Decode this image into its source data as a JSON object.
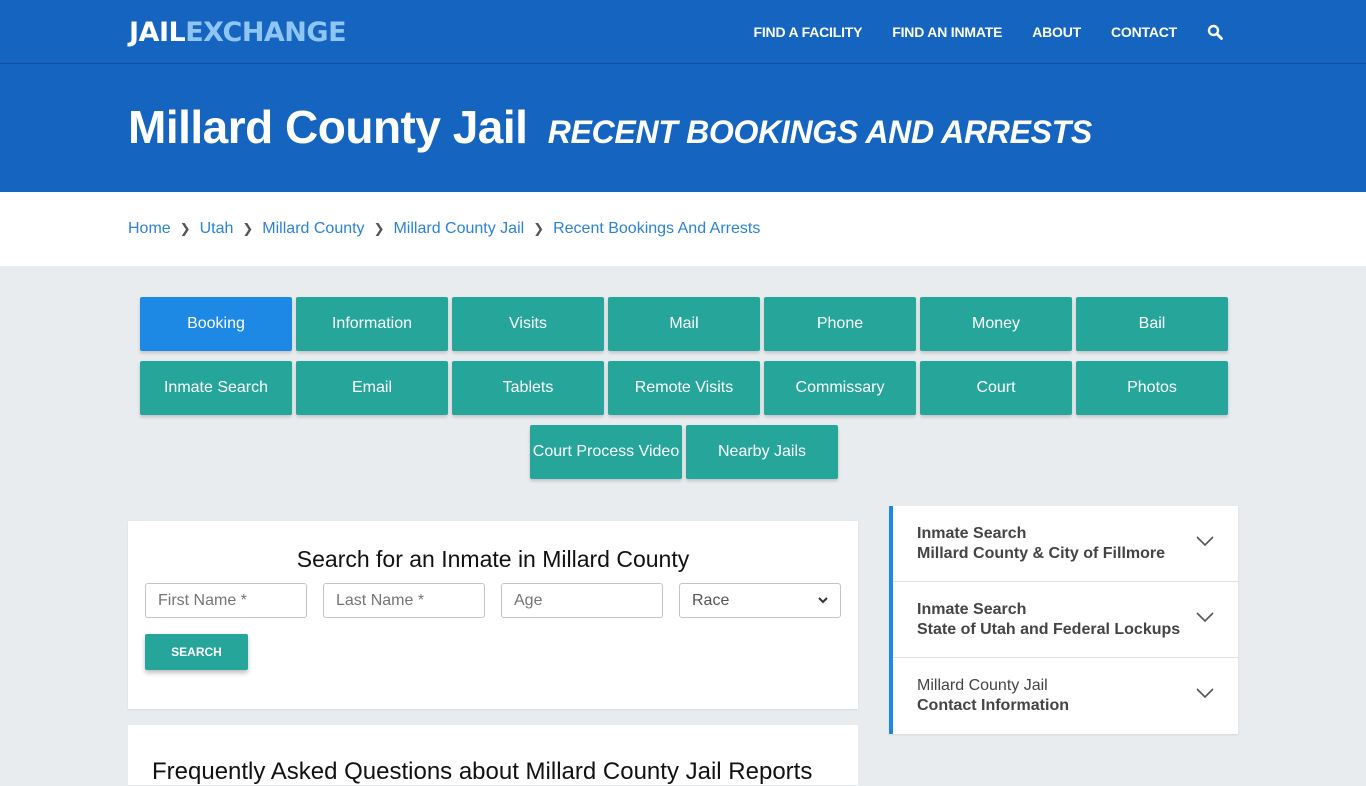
{
  "brand": {
    "part1": "JAIL",
    "part2": "EXCHANGE"
  },
  "nav": {
    "items": [
      "FIND A FACILITY",
      "FIND AN INMATE",
      "ABOUT",
      "CONTACT"
    ],
    "search_icon": "search-icon"
  },
  "hero": {
    "title": "Millard County Jail",
    "subtitle": "RECENT BOOKINGS AND ARRESTS"
  },
  "breadcrumb": [
    "Home",
    "Utah",
    "Millard County",
    "Millard County Jail",
    "Recent Bookings And Arrests"
  ],
  "tabs": {
    "row1": [
      "Booking",
      "Information",
      "Visits",
      "Mail",
      "Phone",
      "Money",
      "Bail"
    ],
    "row2": [
      "Inmate Search",
      "Email",
      "Tablets",
      "Remote Visits",
      "Commissary",
      "Court",
      "Photos"
    ],
    "row3": [
      "Court Process Video",
      "Nearby Jails"
    ],
    "active": "Booking"
  },
  "search": {
    "title": "Search for an Inmate in Millard County",
    "first_name_placeholder": "First Name *",
    "last_name_placeholder": "Last Name *",
    "age_placeholder": "Age",
    "race_selected": "Race",
    "button": "SEARCH"
  },
  "faq": {
    "heading": "Frequently Asked Questions about Millard County Jail Reports"
  },
  "sidebar": [
    {
      "line1": "Inmate Search",
      "line2": "Millard County & City of Fillmore"
    },
    {
      "line1": "Inmate Search",
      "line2": "State of Utah and Federal Lockups"
    },
    {
      "line1": "Millard County Jail",
      "line2": "Contact Information"
    }
  ],
  "colors": {
    "primary": "#1565c0",
    "teal": "#26a69a",
    "active": "#1e88e5",
    "link": "#2b83d6"
  }
}
